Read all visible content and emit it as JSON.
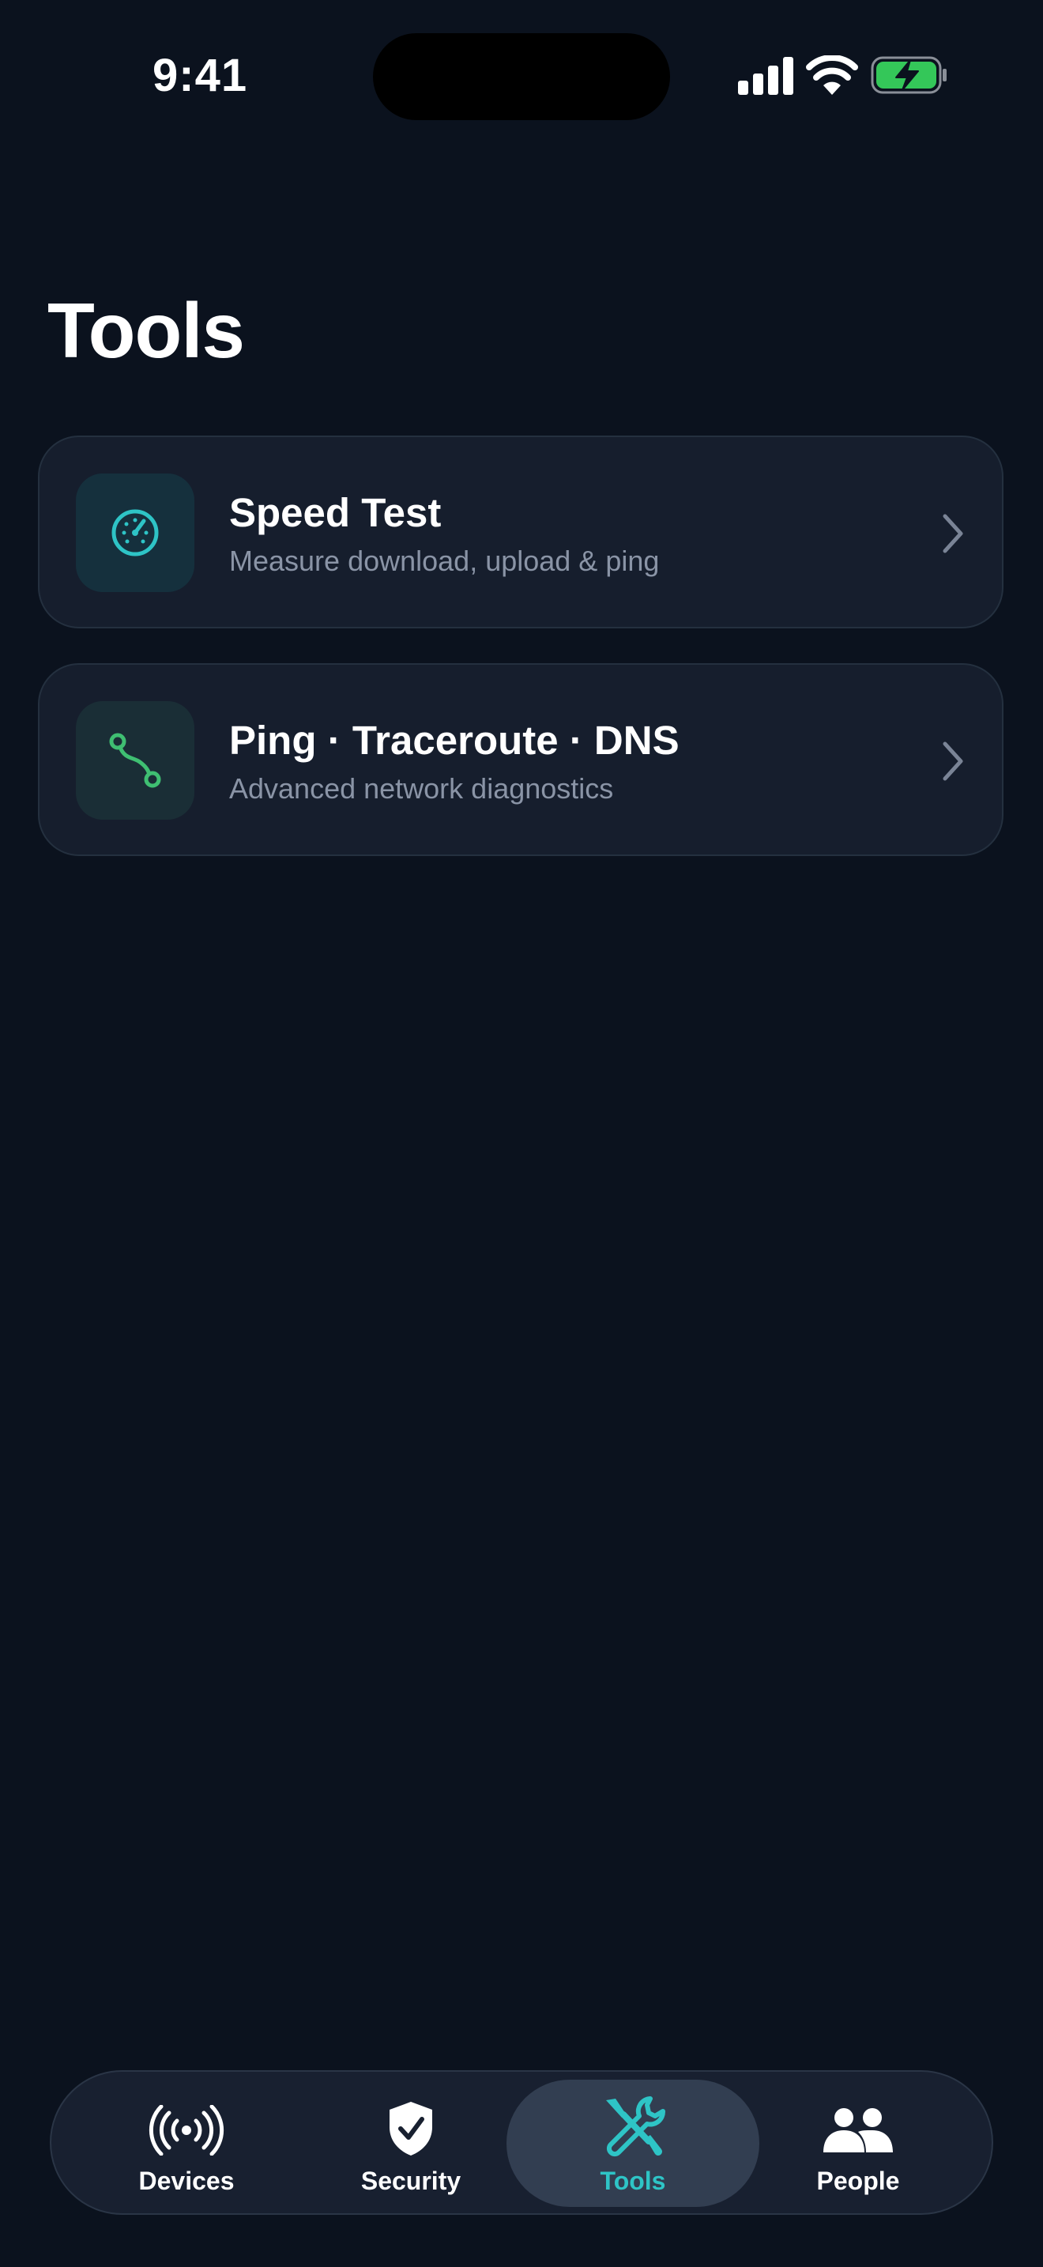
{
  "status_bar": {
    "time": "9:41"
  },
  "page": {
    "title": "Tools"
  },
  "tools": [
    {
      "title": "Speed Test",
      "subtitle": "Measure download, upload & ping",
      "icon": "speedometer-icon"
    },
    {
      "title": "Ping · Traceroute · DNS",
      "subtitle": "Advanced network diagnostics",
      "icon": "route-icon"
    }
  ],
  "tab_bar": {
    "tabs": [
      {
        "label": "Devices",
        "icon": "broadcast-icon",
        "active": false
      },
      {
        "label": "Security",
        "icon": "shield-check-icon",
        "active": false
      },
      {
        "label": "Tools",
        "icon": "tools-icon",
        "active": true
      },
      {
        "label": "People",
        "icon": "people-icon",
        "active": false
      }
    ]
  },
  "colors": {
    "background": "#0b121e",
    "card": "#161e2d",
    "accent": "#2ec4c6",
    "route_green": "#3fbf72",
    "battery_green": "#34c759",
    "subtitle": "#8a94a6"
  }
}
